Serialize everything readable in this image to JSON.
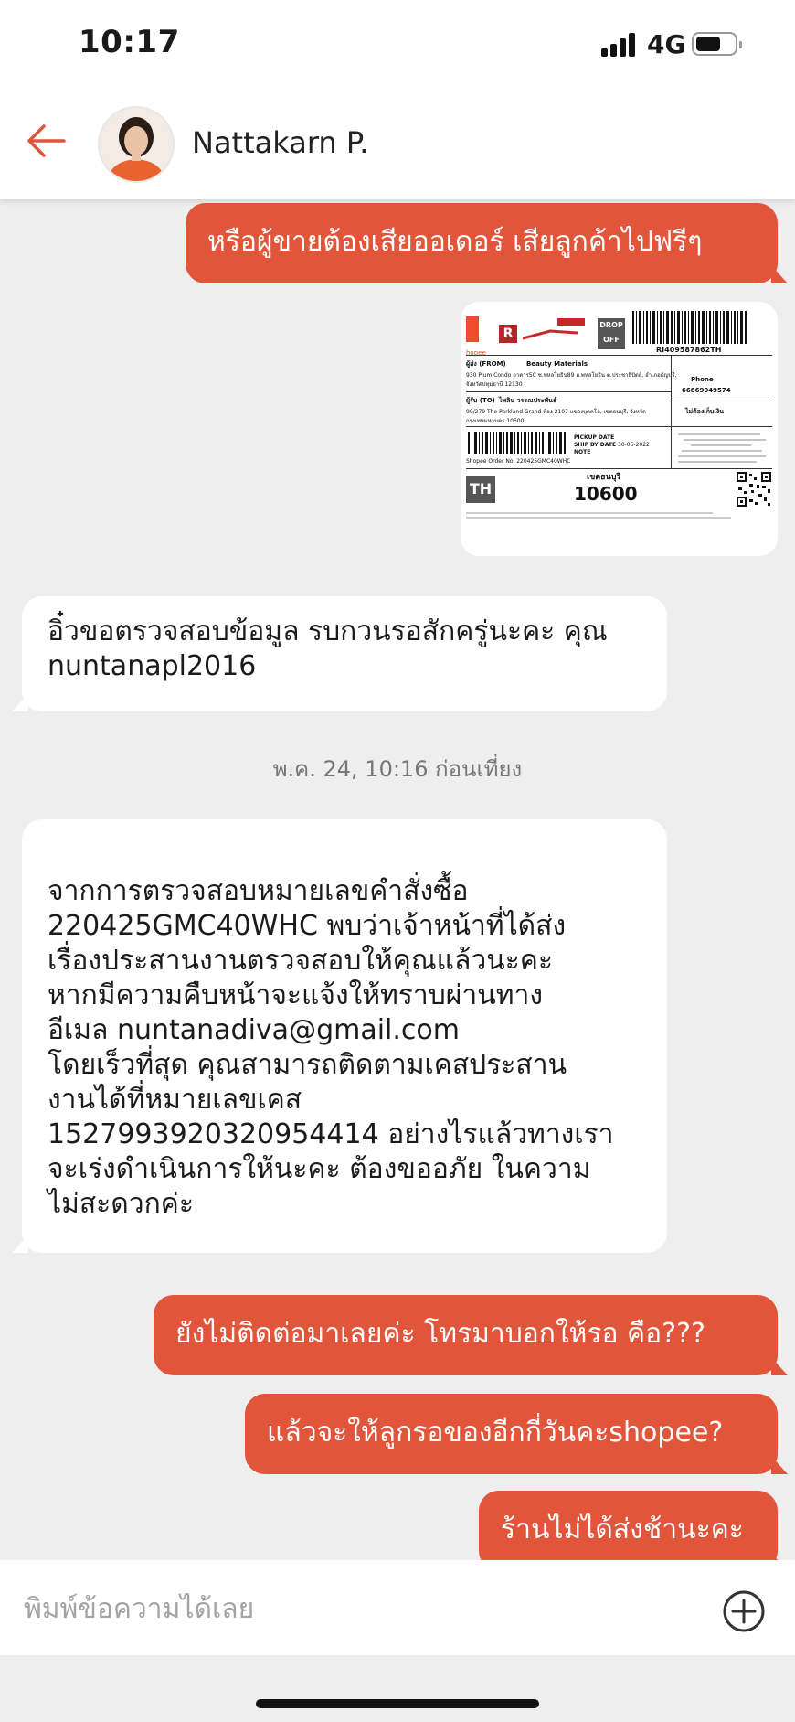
{
  "status_bar": {
    "time": "10:17",
    "network": "4G"
  },
  "header": {
    "contact_name": "Nattakarn P."
  },
  "messages": [
    {
      "side": "out",
      "text": "หรือผู้ขายต้องเสียออเดอร์ เสียลูกค้าไปฟรีๆ"
    },
    {
      "side": "in",
      "text": "อิ๋วขอตรวจสอบข้อมูล รบกวนรอสักครู่นะคะ คุณ\nnuntanapl2016"
    },
    {
      "side": "in",
      "text": "จากการตรวจสอบหมายเลขคำสั่งซื้อ\n220425GMC40WHC พบว่าเจ้าหน้าที่ได้ส่ง\nเรื่องประสานงานตรวจสอบให้คุณแล้วนะคะ\nหากมีความคืบหน้าจะแจ้งให้ทราบผ่านทาง\nอีเมล nuntanadiva@gmail.com\n โดยเร็วที่สุด คุณสามารถติดตามเคสประสาน\nงานได้ที่หมายเลขเคส\n1527993920320954414 อย่างไรแล้วทางเรา\nจะเร่งดำเนินการให้นะคะ ต้องขออภัย ในความ\nไม่สะดวกค่ะ"
    },
    {
      "side": "out",
      "text": "ยังไม่ติดต่อมาเลยค่ะ โทรมาบอกให้รอ คือ???"
    },
    {
      "side": "out",
      "text": "แล้วจะให้ลูกรอของอีกกี่วันคะshopee?"
    },
    {
      "side": "out",
      "text": "ร้านไม่ได้ส่งช้านะคะ"
    }
  ],
  "timestamp": "พ.ค. 24, 10:16 ก่อนเที่ยง",
  "shipping_label": {
    "drop_off": "DROP OFF",
    "tracking_no": "RI409587862TH",
    "from_label": "ผู้ส่ง (FROM)",
    "from_name": "Beauty Materials",
    "from_addr_1": "930 Plum Condo อาคาร5C ซ.พหลโยธิน89 ถ.พหลโยธิน ต.ประชาธิปัตย์, อำเภอธัญบุรี,",
    "from_addr_2": "จังหวัดปทุมธานี 12130",
    "to_label": "ผู้รับ (TO)",
    "to_name": "ไพลิน วรรณประพันธ์",
    "to_addr_1": "99/279 The Parkland Grand ห้อง 2107 แขวงบุคคโล, เขตธนบุรี, จังหวัด",
    "to_addr_2": "กรุงเทพมหานคร 10600",
    "phone_label": "Phone",
    "phone": "66869049574",
    "cod_note": "ไม่ต้องเก็บเงิน",
    "pickup_date": "PICKUP DATE",
    "ship_by_date": "SHIP BY DATE",
    "ship_by_value": "30-05-2022",
    "note": "NOTE",
    "order_no": "Shopee Order No. 220425GMC40WHC",
    "district": "เขตธนบุรี",
    "postcode": "10600",
    "country": "TH"
  },
  "input": {
    "placeholder": "พิมพ์ข้อความได้เลย"
  },
  "colors": {
    "accent": "#e1563b",
    "background": "#efeeee",
    "header": "#ffffff"
  }
}
